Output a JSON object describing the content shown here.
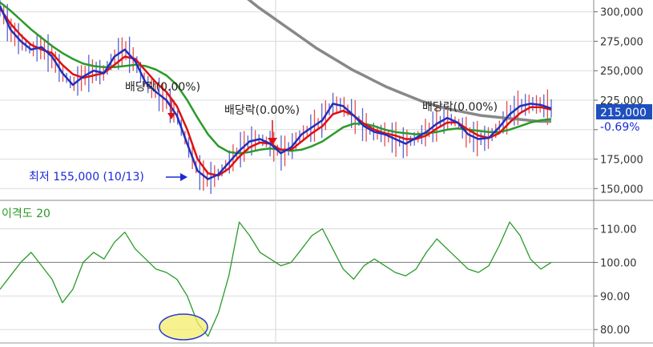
{
  "chart_data": [
    {
      "type": "line",
      "panel": "price",
      "y_tick_labels": [
        "300,000",
        "275,000",
        "250,000",
        "225,000",
        "175,000",
        "150,000"
      ],
      "y_ticks": [
        300000,
        275000,
        250000,
        225000,
        175000,
        150000
      ],
      "ylim": [
        140000,
        310000
      ],
      "current_price_label": "215,000",
      "current_price": 215000,
      "change_label": "-0.69%",
      "grid": true,
      "annotations": {
        "low": "최저 155,000 (10/13)",
        "dividend_1": "배당락(0.00%)",
        "dividend_2": "배당락(0.00%)",
        "dividend_3": "배당락(0.00%)"
      },
      "series": [
        {
          "color": "#1f2fbf",
          "values": [
            305000,
            285000,
            275000,
            268000,
            270000,
            262000,
            248000,
            238000,
            245000,
            250000,
            248000,
            262000,
            268000,
            258000,
            240000,
            232000,
            225000,
            212000,
            188000,
            165000,
            158000,
            162000,
            172000,
            182000,
            190000,
            192000,
            188000,
            180000,
            185000,
            196000,
            202000,
            208000,
            222000,
            220000,
            212000,
            203000,
            198000,
            196000,
            192000,
            188000,
            193000,
            198000,
            205000,
            210000,
            206000,
            196000,
            192000,
            193000,
            202000,
            213000,
            220000,
            222000,
            221000,
            218000
          ]
        },
        {
          "color": "#e01010",
          "values": [
            303000,
            290000,
            280000,
            272000,
            268000,
            265000,
            255000,
            247000,
            244000,
            246000,
            248000,
            255000,
            262000,
            260000,
            250000,
            240000,
            232000,
            220000,
            200000,
            175000,
            163000,
            161000,
            167000,
            177000,
            185000,
            189000,
            188000,
            183000,
            183000,
            190000,
            197000,
            203000,
            213000,
            216000,
            212000,
            205000,
            200000,
            197000,
            195000,
            192000,
            192000,
            195000,
            201000,
            206000,
            206000,
            200000,
            195000,
            193000,
            197000,
            206000,
            214000,
            219000,
            219000,
            217000
          ]
        },
        {
          "color": "#2a9a2a",
          "values": [
            308000,
            301000,
            293000,
            285000,
            278000,
            271000,
            265000,
            260000,
            256000,
            254000,
            253000,
            253000,
            254000,
            255000,
            254000,
            251000,
            246000,
            238000,
            225000,
            210000,
            196000,
            186000,
            181000,
            180000,
            181000,
            183000,
            184000,
            183000,
            182000,
            183000,
            186000,
            190000,
            196000,
            202000,
            205000,
            205000,
            203000,
            200000,
            198000,
            197000,
            196000,
            197000,
            198000,
            200000,
            201000,
            200000,
            199000,
            198000,
            198000,
            200000,
            203000,
            206000,
            208000,
            209000
          ]
        },
        {
          "color": "#888888",
          "values": [
            null,
            null,
            null,
            null,
            null,
            null,
            null,
            null,
            null,
            null,
            null,
            null,
            null,
            null,
            null,
            null,
            null,
            null,
            null,
            null,
            320000,
            312000,
            304000,
            297000,
            290000,
            283000,
            276000,
            269000,
            263000,
            257000,
            251000,
            246000,
            241000,
            236000,
            232000,
            228000,
            224000,
            221000,
            218000,
            216000,
            214000,
            212000,
            211000,
            210000,
            209000,
            208000,
            207000,
            207000
          ]
        }
      ]
    },
    {
      "type": "line",
      "panel": "disparity",
      "title": "이격도 20",
      "y_tick_labels": [
        "110.00",
        "100.00",
        "90.00",
        "80.00"
      ],
      "y_ticks": [
        110,
        100,
        90,
        80
      ],
      "ylim": [
        76,
        118
      ],
      "reference_line": 100,
      "grid": true,
      "series": [
        {
          "color": "#2a9a2a",
          "values": [
            92,
            96,
            100,
            103,
            99,
            95,
            88,
            92,
            100,
            103,
            101,
            106,
            109,
            104,
            101,
            98,
            97,
            95,
            90,
            82,
            78,
            85,
            96,
            112,
            108,
            103,
            101,
            99,
            100,
            104,
            108,
            110,
            104,
            98,
            95,
            99,
            101,
            99,
            97,
            96,
            98,
            103,
            107,
            104,
            101,
            98,
            97,
            99,
            105,
            112,
            108,
            101,
            98,
            100
          ]
        }
      ]
    }
  ]
}
